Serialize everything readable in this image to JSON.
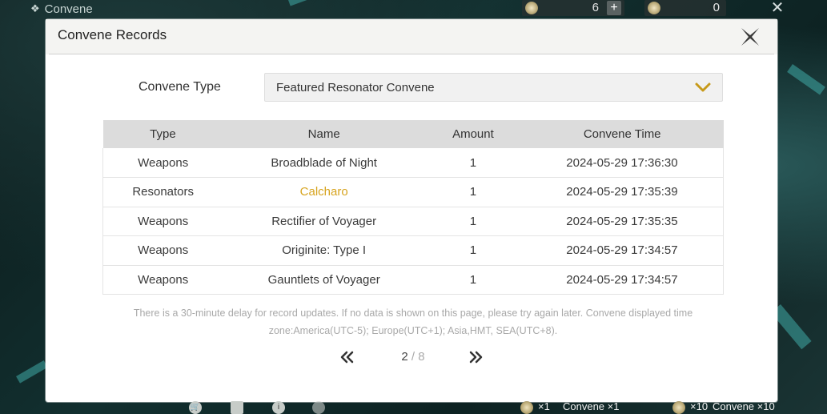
{
  "app": {
    "title": "Convene"
  },
  "currencies": [
    {
      "icon": "astrite-icon",
      "value": "6",
      "plus": "+"
    },
    {
      "icon": "lustrous-tide-icon",
      "value": "0"
    }
  ],
  "dialog": {
    "title": "Convene Records",
    "type_label": "Convene Type",
    "type_value": "Featured Resonator Convene"
  },
  "table": {
    "headers": [
      "Type",
      "Name",
      "Amount",
      "Convene Time"
    ],
    "rows": [
      {
        "type": "Weapons",
        "name": "Broadblade of Night",
        "amount": "1",
        "time": "2024-05-29 17:36:30"
      },
      {
        "type": "Resonators",
        "name": "Calcharo",
        "amount": "1",
        "time": "2024-05-29 17:35:39"
      },
      {
        "type": "Weapons",
        "name": "Rectifier of Voyager",
        "amount": "1",
        "time": "2024-05-29 17:35:35"
      },
      {
        "type": "Weapons",
        "name": "Originite: Type I",
        "amount": "1",
        "time": "2024-05-29 17:34:57"
      },
      {
        "type": "Weapons",
        "name": "Gauntlets of Voyager",
        "amount": "1",
        "time": "2024-05-29 17:34:57"
      }
    ]
  },
  "notice": "There is a 30-minute delay for record updates. If no data is shown on this page, please try again later. Convene displayed time zone:America(UTC-5); Europe(UTC+1); Asia,HMT, SEA(UTC+8).",
  "pagination": {
    "current": "2",
    "separator": "/",
    "total": "8"
  },
  "bottom": {
    "single_count": "×1",
    "single_label": "Convene ×1",
    "multi_count": "×10",
    "multi_label": "Convene ×10"
  },
  "colors": {
    "highlight": "#d7a41f",
    "header_row": "#dcdcdc",
    "background": "#0d2222"
  }
}
